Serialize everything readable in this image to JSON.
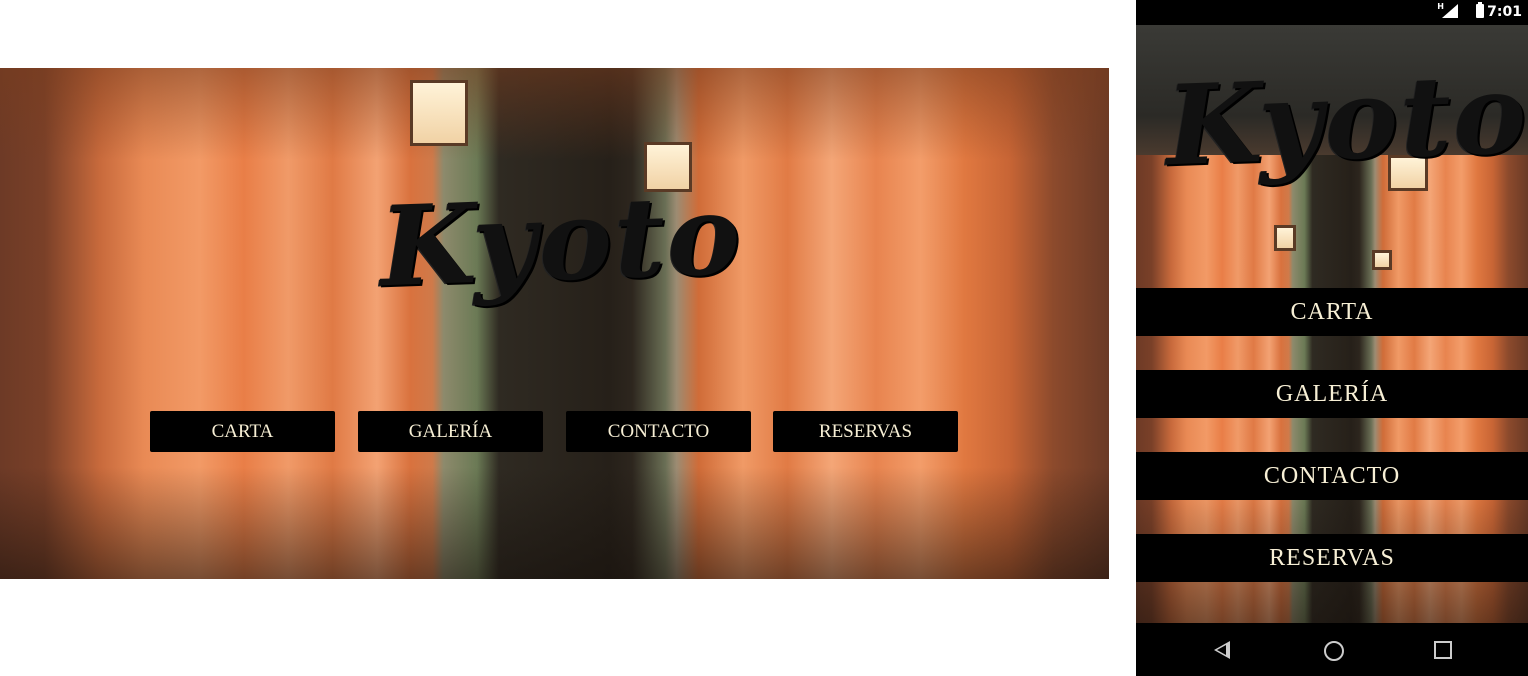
{
  "brand": {
    "title": "Kyoto"
  },
  "desktop": {
    "nav": [
      {
        "label": "CARTA"
      },
      {
        "label": "GALERÍA"
      },
      {
        "label": "CONTACTO"
      },
      {
        "label": "RESERVAS"
      }
    ]
  },
  "mobile": {
    "status": {
      "network": "H",
      "time": "7:01"
    },
    "nav": [
      {
        "label": "CARTA"
      },
      {
        "label": "GALERÍA"
      },
      {
        "label": "CONTACTO"
      },
      {
        "label": "RESERVAS"
      }
    ],
    "system_nav": {
      "icons": [
        "back-icon",
        "home-icon",
        "recent-apps-icon"
      ]
    }
  },
  "colors": {
    "button_bg": "#000000",
    "button_text": "#f7efd5",
    "torii_orange": "#e98a55"
  }
}
